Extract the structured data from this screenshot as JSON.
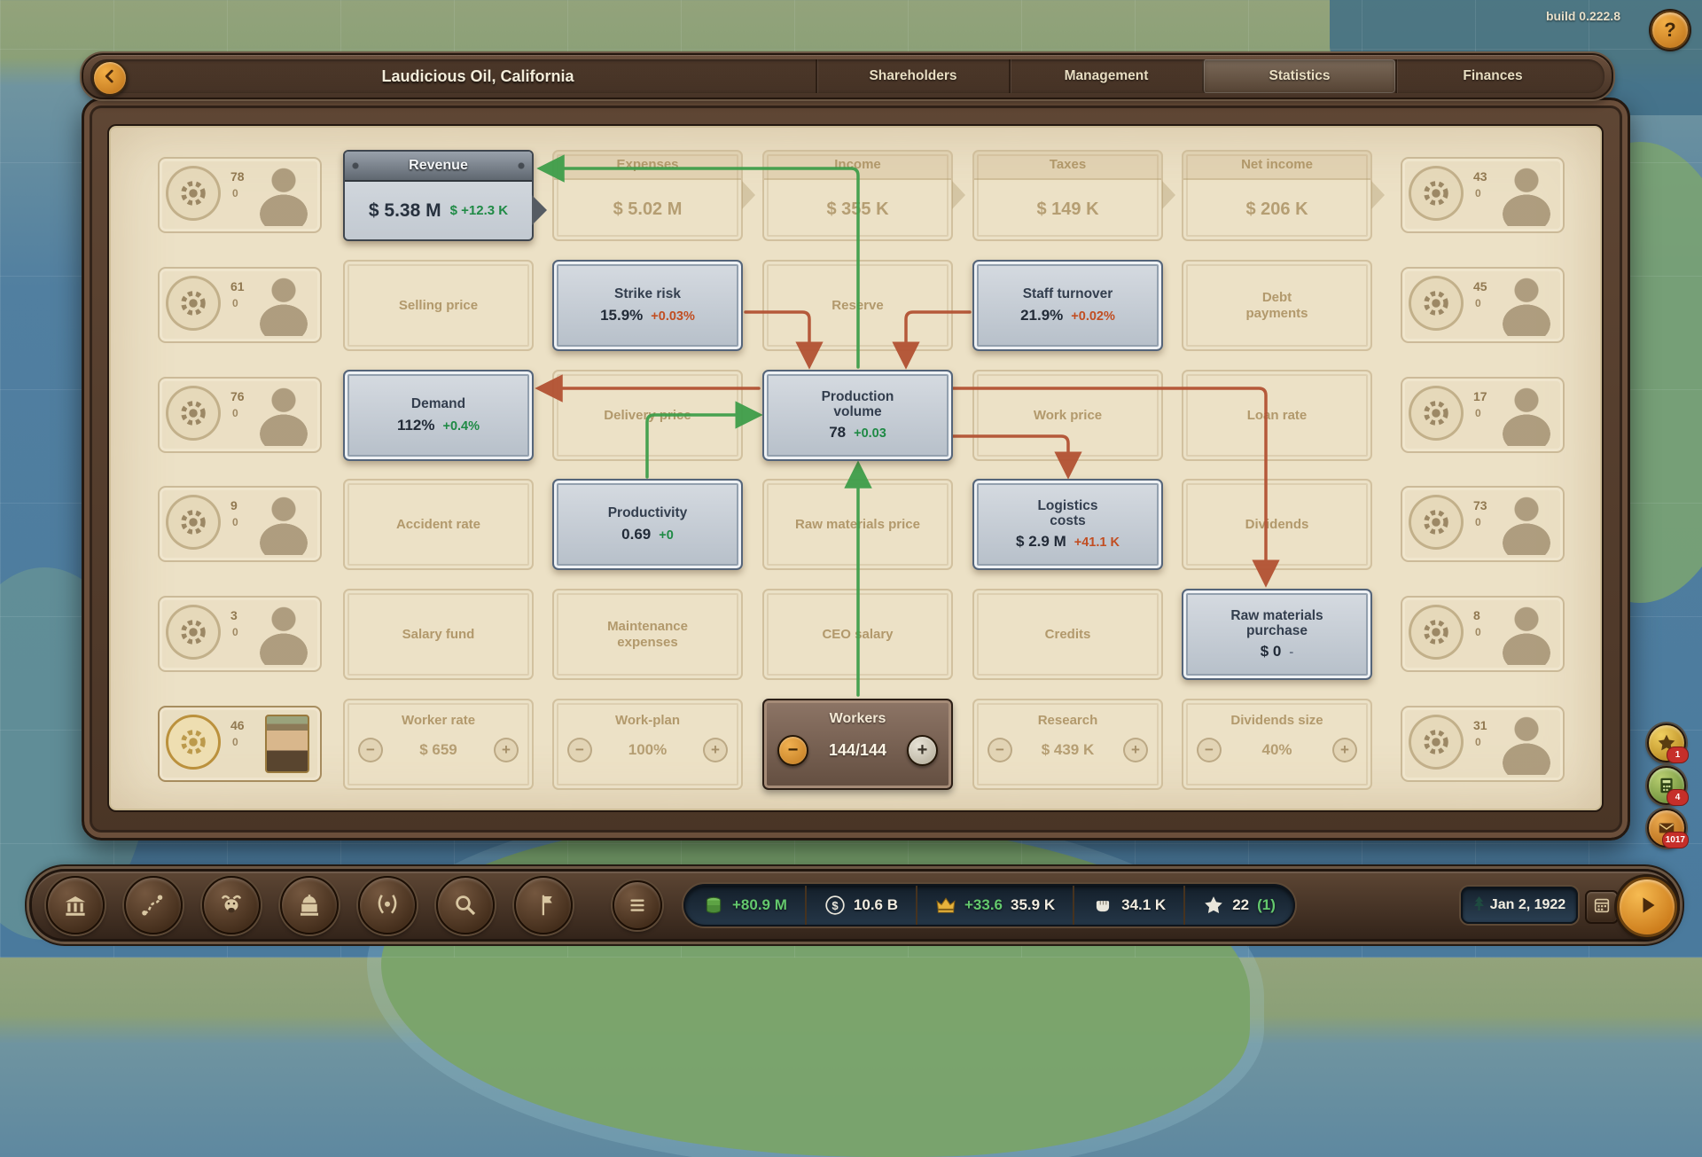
{
  "build_label": "build 0.222.8",
  "help": {
    "label": "?"
  },
  "header": {
    "title": "Laudicious Oil, California",
    "tabs": [
      {
        "label": "Shareholders",
        "active": false
      },
      {
        "label": "Management",
        "active": false
      },
      {
        "label": "Statistics",
        "active": true
      },
      {
        "label": "Finances",
        "active": false
      }
    ]
  },
  "flowchart": {
    "nodes": [
      {
        "id": "revenue",
        "type": "revenue",
        "title": "Revenue",
        "value": "$ 5.38 M",
        "delta": "$ +12.3 K",
        "delta_color": "green",
        "col": 1,
        "row": 1,
        "state": "active"
      },
      {
        "id": "expenses",
        "type": "titled",
        "title": "Expenses",
        "value": "$ 5.02 M",
        "col": 2,
        "row": 1,
        "state": "faded"
      },
      {
        "id": "income",
        "type": "titled",
        "title": "Income",
        "value": "$ 355 K",
        "col": 3,
        "row": 1,
        "state": "faded"
      },
      {
        "id": "taxes",
        "type": "titled",
        "title": "Taxes",
        "value": "$ 149 K",
        "col": 4,
        "row": 1,
        "state": "faded"
      },
      {
        "id": "net-income",
        "type": "titled",
        "title": "Net income",
        "value": "$ 206 K",
        "col": 5,
        "row": 1,
        "state": "faded"
      },
      {
        "id": "selling-price",
        "type": "plain",
        "title": "Selling price",
        "col": 1,
        "row": 2,
        "state": "faded"
      },
      {
        "id": "strike-risk",
        "type": "stat",
        "title": "Strike risk",
        "value": "15.9%",
        "delta": "+0.03%",
        "delta_color": "red",
        "col": 2,
        "row": 2,
        "state": "active"
      },
      {
        "id": "reserve",
        "type": "plain",
        "title": "Reserve",
        "col": 3,
        "row": 2,
        "state": "faded"
      },
      {
        "id": "staff-turnover",
        "type": "stat",
        "title": "Staff turnover",
        "value": "21.9%",
        "delta": "+0.02%",
        "delta_color": "red",
        "col": 4,
        "row": 2,
        "state": "active"
      },
      {
        "id": "debt-payments",
        "type": "plain",
        "title": "Debt\npayments",
        "col": 5,
        "row": 2,
        "state": "faded"
      },
      {
        "id": "demand",
        "type": "stat",
        "title": "Demand",
        "value": "112%",
        "delta": "+0.4%",
        "delta_color": "green",
        "col": 1,
        "row": 3,
        "state": "active"
      },
      {
        "id": "delivery-price",
        "type": "plain",
        "title": "Delivery price",
        "col": 2,
        "row": 3,
        "state": "faded"
      },
      {
        "id": "production-volume",
        "type": "stat",
        "title": "Production\nvolume",
        "value": "78",
        "delta": "+0.03",
        "delta_color": "green",
        "col": 3,
        "row": 3,
        "state": "active"
      },
      {
        "id": "work-price",
        "type": "plain",
        "title": "Work price",
        "col": 4,
        "row": 3,
        "state": "faded"
      },
      {
        "id": "loan-rate",
        "type": "plain",
        "title": "Loan rate",
        "col": 5,
        "row": 3,
        "state": "faded"
      },
      {
        "id": "accident-rate",
        "type": "plain",
        "title": "Accident rate",
        "col": 1,
        "row": 4,
        "state": "faded"
      },
      {
        "id": "productivity",
        "type": "stat",
        "title": "Productivity",
        "value": "0.69",
        "delta": "+0",
        "delta_color": "green",
        "col": 2,
        "row": 4,
        "state": "active"
      },
      {
        "id": "raw-materials-price",
        "type": "plain",
        "title": "Raw materials price",
        "col": 3,
        "row": 4,
        "state": "faded"
      },
      {
        "id": "logistics-costs",
        "type": "stat",
        "title": "Logistics\ncosts",
        "value": "$ 2.9 M",
        "delta": "+41.1 K",
        "delta_color": "red",
        "col": 4,
        "row": 4,
        "state": "active"
      },
      {
        "id": "dividends",
        "type": "plain",
        "title": "Dividends",
        "col": 5,
        "row": 4,
        "state": "faded"
      },
      {
        "id": "salary-fund",
        "type": "plain",
        "title": "Salary fund",
        "col": 1,
        "row": 5,
        "state": "faded"
      },
      {
        "id": "maintenance-expenses",
        "type": "plain",
        "title": "Maintenance\nexpenses",
        "col": 2,
        "row": 5,
        "state": "faded"
      },
      {
        "id": "ceo-salary",
        "type": "plain",
        "title": "CEO salary",
        "col": 3,
        "row": 5,
        "state": "faded"
      },
      {
        "id": "credits",
        "type": "plain",
        "title": "Credits",
        "col": 4,
        "row": 5,
        "state": "faded"
      },
      {
        "id": "raw-materials-purchase",
        "type": "stat",
        "title": "Raw materials\npurchase",
        "value": "$ 0",
        "delta": "-",
        "delta_color": "gray",
        "col": 5,
        "row": 5,
        "state": "active"
      },
      {
        "id": "worker-rate",
        "type": "stepper",
        "title": "Worker rate",
        "value": "$ 659",
        "col": 1,
        "row": 6,
        "state": "faded"
      },
      {
        "id": "work-plan",
        "type": "stepper",
        "title": "Work-plan",
        "value": "100%",
        "col": 2,
        "row": 6,
        "state": "faded"
      },
      {
        "id": "workers",
        "type": "workers",
        "title": "Workers",
        "value": "144/144",
        "col": 3,
        "row": 6,
        "state": "active"
      },
      {
        "id": "research",
        "type": "stepper",
        "title": "Research",
        "value": "$ 439 K",
        "col": 4,
        "row": 6,
        "state": "faded"
      },
      {
        "id": "dividends-size",
        "type": "stepper",
        "title": "Dividends size",
        "value": "40%",
        "col": 5,
        "row": 6,
        "state": "faded"
      }
    ]
  },
  "people": {
    "left": [
      {
        "badge": "78",
        "sub": "0"
      },
      {
        "badge": "61",
        "sub": "0"
      },
      {
        "badge": "76",
        "sub": "0"
      },
      {
        "badge": "9",
        "sub": "0"
      },
      {
        "badge": "3",
        "sub": "0"
      },
      {
        "badge": "46",
        "sub": "0",
        "portrait": true
      }
    ],
    "right": [
      {
        "badge": "43",
        "sub": "0"
      },
      {
        "badge": "45",
        "sub": "0"
      },
      {
        "badge": "17",
        "sub": "0"
      },
      {
        "badge": "73",
        "sub": "0"
      },
      {
        "badge": "8",
        "sub": "0"
      },
      {
        "badge": "31",
        "sub": "0"
      }
    ]
  },
  "notifications": [
    {
      "name": "achievements",
      "icon": "star",
      "badge": "1"
    },
    {
      "name": "ledger",
      "icon": "ledger",
      "badge": "4"
    },
    {
      "name": "mail",
      "icon": "mail",
      "badge": "1017"
    }
  ],
  "bottom_bar": {
    "buttons": [
      {
        "name": "company"
      },
      {
        "name": "routes"
      },
      {
        "name": "market"
      },
      {
        "name": "government"
      },
      {
        "name": "awards"
      },
      {
        "name": "search"
      },
      {
        "name": "flag"
      }
    ],
    "indicators": [
      {
        "name": "cash-flow",
        "icon": "coins",
        "parts": [
          {
            "text": "+80.9 M",
            "color": "green"
          }
        ]
      },
      {
        "name": "money",
        "icon": "dollar",
        "parts": [
          {
            "text": "10.6 B",
            "color": "white"
          }
        ]
      },
      {
        "name": "influence",
        "icon": "crown",
        "parts": [
          {
            "text": "+33.6",
            "color": "green"
          },
          {
            "text": "35.9 K",
            "color": "white"
          }
        ]
      },
      {
        "name": "power",
        "icon": "fist",
        "parts": [
          {
            "text": "34.1 K",
            "color": "white"
          }
        ]
      },
      {
        "name": "prestige",
        "icon": "starw",
        "parts": [
          {
            "text": "22",
            "color": "white"
          },
          {
            "text": "(1)",
            "color": "green"
          }
        ]
      }
    ],
    "date": {
      "label": "Jan 2, 1922"
    }
  },
  "colors": {
    "positive": "#1f8a45",
    "negative": "#c14e22",
    "arrow_green": "#3f9e4a",
    "arrow_red": "#b35233",
    "accent_orange": "#e09a35"
  }
}
